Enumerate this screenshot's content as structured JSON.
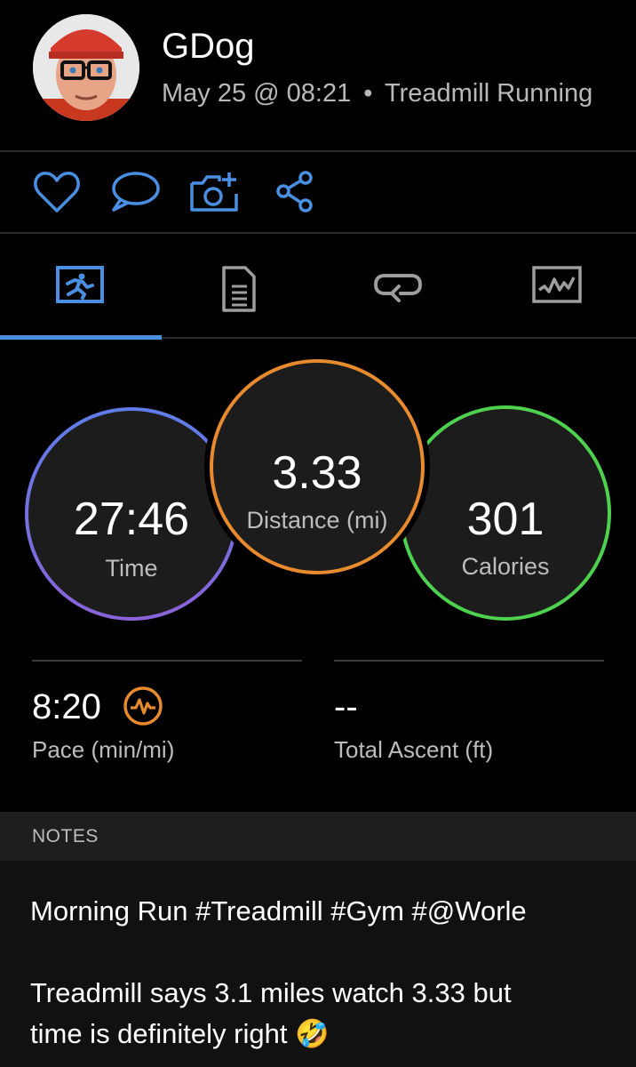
{
  "header": {
    "username": "GDog",
    "date_time": "May 25 @ 08:21",
    "separator": "•",
    "activity_type": "Treadmill Running"
  },
  "actions": [
    {
      "name": "like",
      "icon": "heart-icon"
    },
    {
      "name": "comment",
      "icon": "comment-icon"
    },
    {
      "name": "add-photo",
      "icon": "camera-plus-icon"
    },
    {
      "name": "share",
      "icon": "share-icon"
    }
  ],
  "tabs": [
    {
      "name": "overview",
      "icon": "runner-icon",
      "active": true
    },
    {
      "name": "details",
      "icon": "document-icon",
      "active": false
    },
    {
      "name": "laps",
      "icon": "loop-icon",
      "active": false
    },
    {
      "name": "graphs",
      "icon": "chart-icon",
      "active": false
    }
  ],
  "metrics": {
    "time": {
      "value": "27:46",
      "label": "Time",
      "ring_color": "#6c7cf0"
    },
    "distance": {
      "value": "3.33",
      "label": "Distance (mi)",
      "ring_color": "#e88a2e"
    },
    "calories": {
      "value": "301",
      "label": "Calories",
      "ring_color": "#4ed14e"
    }
  },
  "stats": {
    "pace": {
      "value": "8:20",
      "label": "Pace (min/mi)",
      "icon": "heart-rate-icon",
      "icon_color": "#e88a2e"
    },
    "ascent": {
      "value": "--",
      "label": "Total Ascent (ft)"
    }
  },
  "notes": {
    "heading": "NOTES",
    "line1": "Morning Run #Treadmill #Gym #@Worle",
    "line2": "Treadmill says 3.1 miles watch 3.33 but",
    "line3": "time is definitely right",
    "emoji": "🤣"
  },
  "colors": {
    "accent": "#4a90e2",
    "background": "#000000"
  }
}
